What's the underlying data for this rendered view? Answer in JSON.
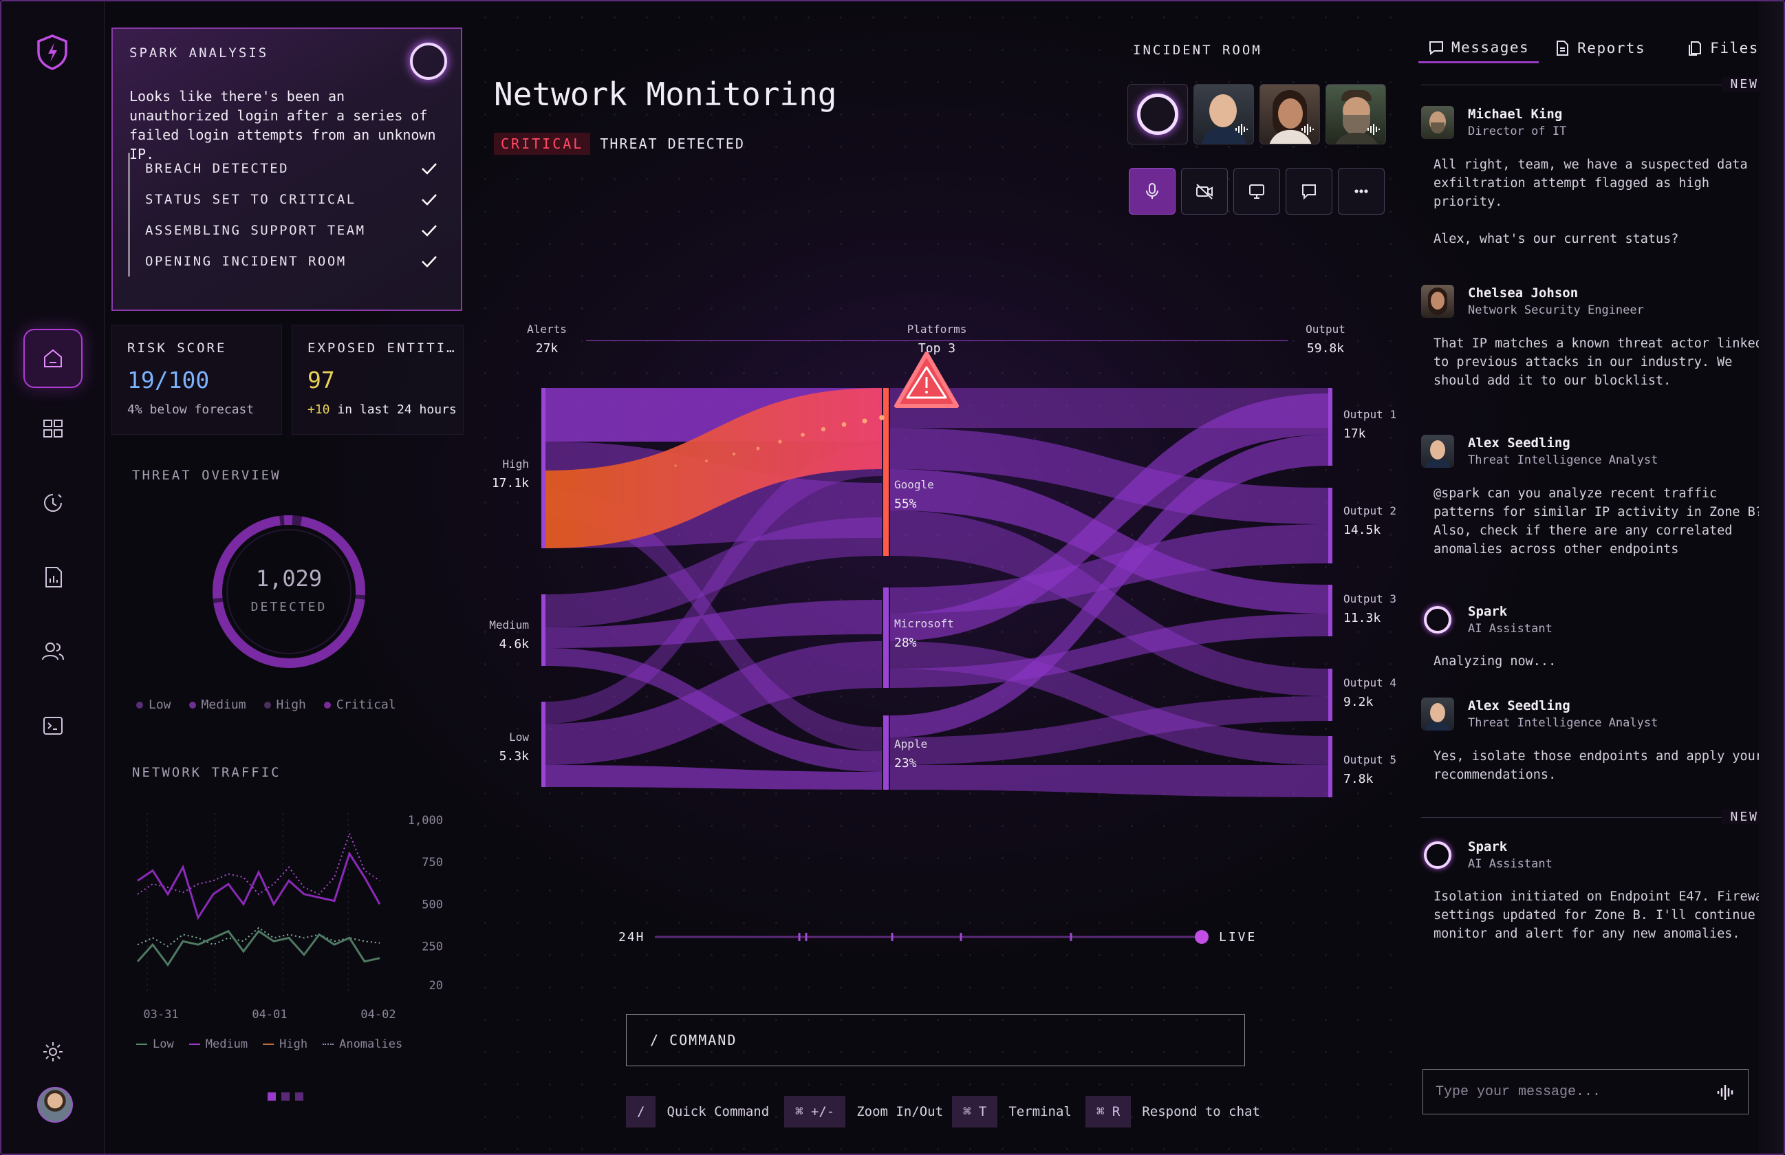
{
  "colors": {
    "accent": "#b03bd6",
    "critical": "#ff4a64",
    "risk": "#7db3ff",
    "exposed": "#e8d25a",
    "sankey": "#8a35c4",
    "highlight": "#f0523c"
  },
  "sidebar": {
    "items": [
      "home-icon",
      "dashboard-icon",
      "history-icon",
      "report-icon",
      "users-icon",
      "terminal-icon"
    ],
    "settings": "gear-icon"
  },
  "spark": {
    "title": "SPARK ANALYSIS",
    "message": "Looks like there's been an unauthorized login after a series of failed login attempts from an unknown IP.",
    "steps": [
      "BREACH DETECTED",
      "STATUS SET TO CRITICAL",
      "ASSEMBLING SUPPORT TEAM",
      "OPENING INCIDENT ROOM"
    ]
  },
  "risk": {
    "label": "RISK SCORE",
    "value": "19/100",
    "sub": "4% below forecast"
  },
  "exposed": {
    "label": "EXPOSED ENTITI…",
    "value": "97",
    "sub_delta": "+10",
    "sub_rest": " in last 24 hours"
  },
  "threat": {
    "title": "THREAT OVERVIEW",
    "count": "1,029",
    "count_label": "DETECTED",
    "legend": [
      "Low",
      "Medium",
      "High",
      "Critical"
    ]
  },
  "traffic": {
    "title": "NETWORK TRAFFIC",
    "legend": [
      "Low",
      "Medium",
      "High",
      "Anomalies"
    ],
    "yticks": [
      "1,000",
      "750",
      "500",
      "250",
      "20"
    ],
    "xticks": [
      "03-31",
      "04-01",
      "04-02"
    ],
    "medium": [
      640,
      700,
      560,
      720,
      420,
      560,
      620,
      500,
      690,
      500,
      640,
      560,
      540,
      520,
      800,
      660,
      500
    ],
    "anomalies": [
      560,
      620,
      600,
      570,
      620,
      640,
      680,
      660,
      560,
      620,
      720,
      600,
      560,
      660,
      920,
      700,
      640
    ],
    "low": [
      160,
      260,
      140,
      280,
      260,
      300,
      340,
      220,
      340,
      280,
      300,
      200,
      320,
      260,
      300,
      160,
      180
    ],
    "lowdots": [
      260,
      300,
      250,
      320,
      300,
      260,
      300,
      280,
      360,
      300,
      320,
      300,
      320,
      280,
      300,
      280,
      270
    ]
  },
  "main": {
    "title": "Network Monitoring",
    "tag": "CRITICAL",
    "status": "THREAT DETECTED"
  },
  "incident": {
    "title": "INCIDENT ROOM"
  },
  "sankey": {
    "cols": {
      "alerts": {
        "label": "Alerts",
        "value": "27k"
      },
      "platforms": {
        "label": "Platforms",
        "value": "Top 3"
      },
      "output": {
        "label": "Output",
        "value": "59.8k"
      }
    },
    "sources": [
      {
        "name": "High",
        "value": "17.1k"
      },
      {
        "name": "Medium",
        "value": "4.6k"
      },
      {
        "name": "Low",
        "value": "5.3k"
      }
    ],
    "platforms": [
      {
        "name": "Google",
        "value": "55%"
      },
      {
        "name": "Microsoft",
        "value": "28%"
      },
      {
        "name": "Apple",
        "value": "23%"
      }
    ],
    "outputs": [
      {
        "name": "Output 1",
        "value": "17k"
      },
      {
        "name": "Output 2",
        "value": "14.5k"
      },
      {
        "name": "Output 3",
        "value": "11.3k"
      },
      {
        "name": "Output 4",
        "value": "9.2k"
      },
      {
        "name": "Output 5",
        "value": "7.8k"
      }
    ]
  },
  "timeline": {
    "start": "24H",
    "end": "LIVE"
  },
  "command": {
    "label": "/ COMMAND"
  },
  "shortcuts": [
    {
      "key": "/",
      "label": "Quick Command"
    },
    {
      "key": "⌘ +/-",
      "label": "Zoom In/Out"
    },
    {
      "key": "⌘ T",
      "label": "Terminal"
    },
    {
      "key": "⌘ R",
      "label": "Respond to chat"
    }
  ],
  "chat": {
    "tabs": [
      "Messages",
      "Reports",
      "Files"
    ],
    "new_label": "NEW",
    "messages": [
      {
        "name": "Michael King",
        "role": "Director of IT",
        "text": "All right, team, we have a suspected data exfiltration attempt flagged as high priority.\n\nAlex, what's our current status?"
      },
      {
        "name": "Chelsea Johson",
        "role": "Network Security Engineer",
        "text": "That IP matches a known threat actor linked to previous attacks in our industry. We should add it to our blocklist."
      },
      {
        "name": "Alex Seedling",
        "role": "Threat Intelligence Analyst",
        "text": "@spark can you analyze recent traffic patterns for similar IP activity in Zone B? Also, check if there are any correlated anomalies across other endpoints"
      },
      {
        "name": "Spark",
        "role": "AI Assistant",
        "text": "Analyzing now..."
      },
      {
        "name": "Alex Seedling",
        "role": "Threat Intelligence Analyst",
        "text": "Yes, isolate those endpoints and apply your recommendations."
      },
      {
        "name": "Spark",
        "role": "AI Assistant",
        "text": "Isolation initiated on Endpoint E47. Firewall settings updated for Zone B. I'll continue to monitor and alert for any new anomalies."
      }
    ],
    "placeholder": "Type your message..."
  }
}
